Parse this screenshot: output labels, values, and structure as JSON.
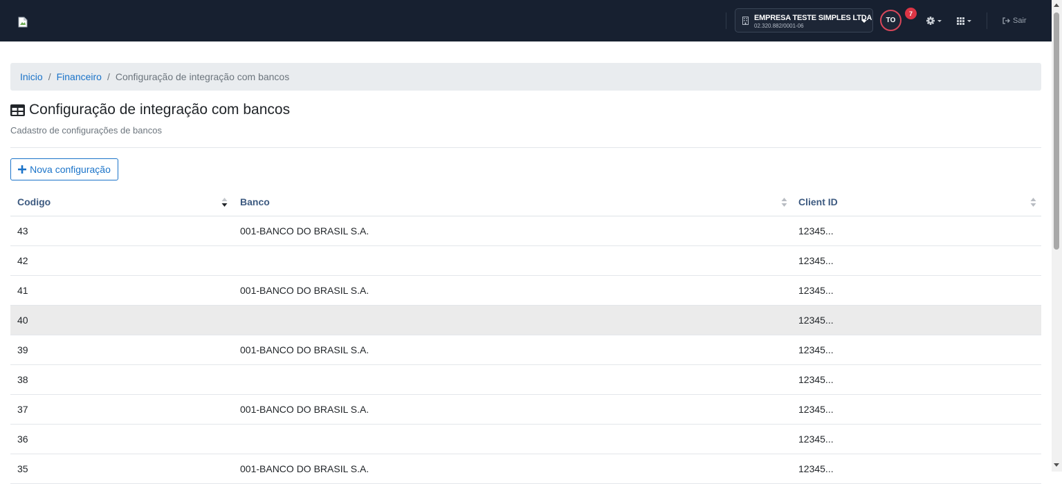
{
  "header": {
    "company_name": "EMPRESA TESTE SIMPLES LTDA",
    "company_cnpj": "02.320.882/0001-06",
    "avatar_initials": "TO",
    "notification_count": "7",
    "logout_label": "Sair",
    "icons": [
      "broken-image-icon",
      "building-icon",
      "gear-icon",
      "grid-icon",
      "logout-icon"
    ]
  },
  "breadcrumb": {
    "items": [
      "Inicio",
      "Financeiro"
    ],
    "current": "Configuração de integração com bancos"
  },
  "page": {
    "title": "Configuração de integração com bancos",
    "subtitle": "Cadastro de configurações de bancos",
    "new_button": "Nova configuração"
  },
  "table": {
    "columns": [
      "Codigo",
      "Banco",
      "Client ID"
    ],
    "rows": [
      {
        "codigo": "43",
        "banco": "001-BANCO DO BRASIL S.A.",
        "client_id": "12345..."
      },
      {
        "codigo": "42",
        "banco": "",
        "client_id": "12345..."
      },
      {
        "codigo": "41",
        "banco": "001-BANCO DO BRASIL S.A.",
        "client_id": "12345..."
      },
      {
        "codigo": "40",
        "banco": "",
        "client_id": "12345..."
      },
      {
        "codigo": "39",
        "banco": "001-BANCO DO BRASIL S.A.",
        "client_id": "12345..."
      },
      {
        "codigo": "38",
        "banco": "",
        "client_id": "12345..."
      },
      {
        "codigo": "37",
        "banco": "001-BANCO DO BRASIL S.A.",
        "client_id": "12345..."
      },
      {
        "codigo": "36",
        "banco": "",
        "client_id": "12345..."
      },
      {
        "codigo": "35",
        "banco": "001-BANCO DO BRASIL S.A.",
        "client_id": "12345..."
      }
    ]
  },
  "colors": {
    "topbar": "#172030",
    "link": "#1a73c9",
    "header_text": "#3d5a80",
    "badge": "#dc3545",
    "row_highlight": "#ebebeb"
  }
}
